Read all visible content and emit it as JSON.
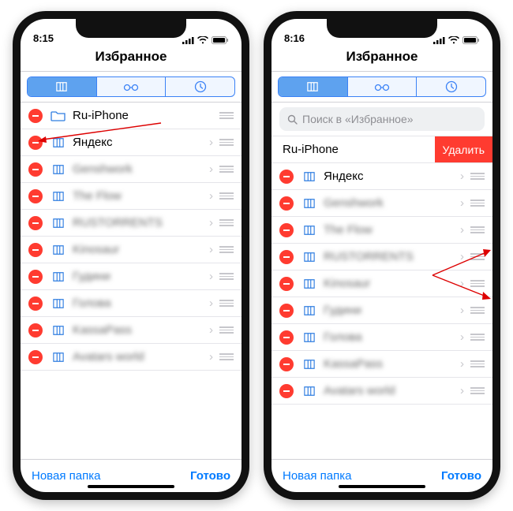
{
  "left": {
    "time": "8:15",
    "title": "Избранное",
    "items": [
      {
        "label": "Ru-iPhone",
        "icon": "folder",
        "blurred": false,
        "chevron": false
      },
      {
        "label": "Яндекс",
        "icon": "book",
        "blurred": false,
        "chevron": true
      },
      {
        "label": "Genshwork",
        "icon": "book",
        "blurred": true,
        "chevron": true
      },
      {
        "label": "The Flow",
        "icon": "book",
        "blurred": true,
        "chevron": true
      },
      {
        "label": "RUSTORRENTS",
        "icon": "book",
        "blurred": true,
        "chevron": true
      },
      {
        "label": "Kinosaur",
        "icon": "book",
        "blurred": true,
        "chevron": true
      },
      {
        "label": "Гудини",
        "icon": "book",
        "blurred": true,
        "chevron": true
      },
      {
        "label": "Голова",
        "icon": "book",
        "blurred": true,
        "chevron": true
      },
      {
        "label": "KassaPass",
        "icon": "book",
        "blurred": true,
        "chevron": true
      },
      {
        "label": "Avatars world",
        "icon": "book",
        "blurred": true,
        "chevron": true
      }
    ],
    "toolbar": {
      "left": "Новая папка",
      "right": "Готово"
    }
  },
  "right": {
    "time": "8:16",
    "title": "Избранное",
    "search_placeholder": "Поиск в «Избранное»",
    "swiped": {
      "label": "Ru-iPhone",
      "delete": "Удалить"
    },
    "items": [
      {
        "label": "Яндекс",
        "icon": "book",
        "blurred": false,
        "chevron": true
      },
      {
        "label": "Genshwork",
        "icon": "book",
        "blurred": true,
        "chevron": true
      },
      {
        "label": "The Flow",
        "icon": "book",
        "blurred": true,
        "chevron": true
      },
      {
        "label": "RUSTORRENTS",
        "icon": "book",
        "blurred": true,
        "chevron": true
      },
      {
        "label": "Kinosaur",
        "icon": "book",
        "blurred": true,
        "chevron": true
      },
      {
        "label": "Гудини",
        "icon": "book",
        "blurred": true,
        "chevron": true
      },
      {
        "label": "Голова",
        "icon": "book",
        "blurred": true,
        "chevron": true
      },
      {
        "label": "KassaPass",
        "icon": "book",
        "blurred": true,
        "chevron": true
      },
      {
        "label": "Avatars world",
        "icon": "book",
        "blurred": true,
        "chevron": true
      }
    ],
    "toolbar": {
      "left": "Новая папка",
      "right": "Готово"
    }
  },
  "icons": {
    "book": "bookmark-icon",
    "folder": "folder-icon",
    "glasses": "reading-list-icon",
    "clock": "history-icon",
    "search": "search-icon"
  },
  "colors": {
    "accent": "#007aff",
    "danger": "#ff3b30",
    "segActive": "#5ea2ef"
  }
}
